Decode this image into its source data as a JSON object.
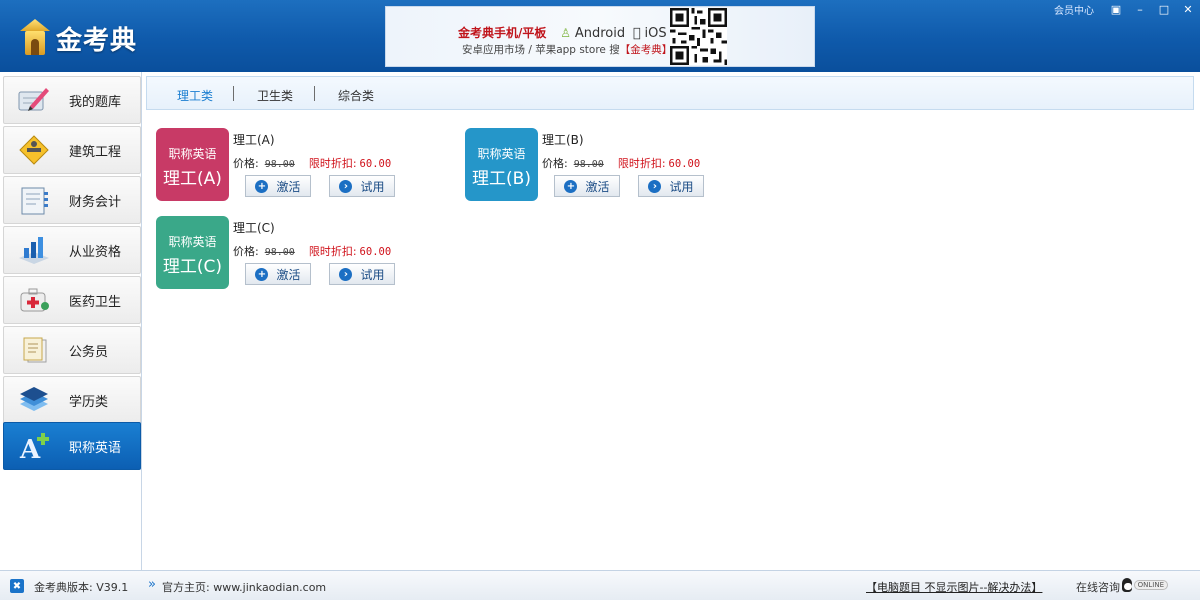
{
  "app": {
    "name": "金考典",
    "member_center": "会员中心"
  },
  "banner": {
    "title_red": "金考典手机/平板",
    "android": "Android",
    "ios": "iOS",
    "subtitle": "安卓应用市场 / 苹果app store 搜",
    "subtitle_red": "【金考典】"
  },
  "sidebar": {
    "items": [
      {
        "label": "我的题库",
        "icon": "pencil-notebook-icon"
      },
      {
        "label": "建筑工程",
        "icon": "construction-sign-icon"
      },
      {
        "label": "财务会计",
        "icon": "ledger-icon"
      },
      {
        "label": "从业资格",
        "icon": "bar-chart-icon"
      },
      {
        "label": "医药卫生",
        "icon": "medical-kit-icon"
      },
      {
        "label": "公务员",
        "icon": "document-stack-icon"
      },
      {
        "label": "学历类",
        "icon": "layers-icon"
      },
      {
        "label": "职称英语",
        "icon": "letter-a-plus-icon"
      }
    ],
    "active_index": 7
  },
  "tabs": [
    {
      "label": "理工类",
      "active": true
    },
    {
      "label": "卫生类",
      "active": false
    },
    {
      "label": "综合类",
      "active": false
    }
  ],
  "products": [
    {
      "tile_top": "职称英语",
      "tile_bottom": "理工(A)",
      "name": "理工(A)",
      "price_label": "价格:",
      "old_price": "98.00",
      "promo_label": "限时折扣:",
      "promo_price": "60.00",
      "activate": "激活",
      "trial": "试用",
      "color": "#c83a66"
    },
    {
      "tile_top": "职称英语",
      "tile_bottom": "理工(B)",
      "name": "理工(B)",
      "price_label": "价格:",
      "old_price": "98.00",
      "promo_label": "限时折扣:",
      "promo_price": "60.00",
      "activate": "激活",
      "trial": "试用",
      "color": "#2596c9"
    },
    {
      "tile_top": "职称英语",
      "tile_bottom": "理工(C)",
      "name": "理工(C)",
      "price_label": "价格:",
      "old_price": "98.00",
      "promo_label": "限时折扣:",
      "promo_price": "60.00",
      "activate": "激活",
      "trial": "试用",
      "color": "#3aa889"
    }
  ],
  "statusbar": {
    "version": "金考典版本: V39.1",
    "homepage": "官方主页: www.jinkaodian.com",
    "fix_link": "【电脑题目 不显示图片--解决办法】",
    "consult": "在线咨询",
    "online": "ONLINE"
  }
}
